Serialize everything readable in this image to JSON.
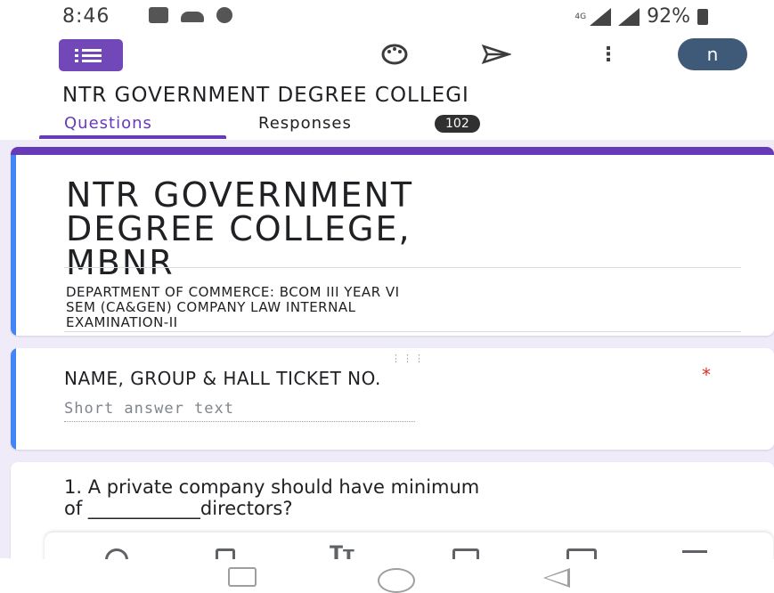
{
  "status_bar": {
    "time": "8:46",
    "network_label": "4G",
    "battery": "92%",
    "icons": [
      "usb-icon",
      "cloud-icon",
      "phone-icon",
      "signal-icon",
      "battery-icon"
    ]
  },
  "toolbar": {
    "app_icon": "google-forms-icon",
    "actions": [
      "palette-icon",
      "send-icon",
      "more-vert-icon"
    ],
    "avatar_initial": "n",
    "avatar_color": "#3f5a78"
  },
  "form_header_title": "NTR GOVERNMENT DEGREE COLLEGI",
  "tabs": {
    "questions": "Questions",
    "responses": "Responses",
    "responses_count": "102",
    "accent": "#673ab7"
  },
  "title_card": {
    "title_lines": [
      "NTR GOVERNMENT",
      "DEGREE COLLEGE,",
      "MBNR"
    ],
    "description_lines": [
      "DEPARTMENT OF COMMERCE: BCOM III YEAR VI",
      "SEM (CA&GEN) COMPANY LAW INTERNAL",
      "EXAMINATION-II"
    ]
  },
  "question_1": {
    "title": "NAME, GROUP & HALL TICKET NO.",
    "required_mark": "*",
    "answer_placeholder": "Short answer text"
  },
  "question_2": {
    "line1": "1. A private company should have minimum",
    "line2": "of ____________directors?"
  },
  "bottom_toolbar": {
    "icons": [
      "add-question-icon",
      "import-questions-icon",
      "add-title-icon",
      "add-image-icon",
      "add-video-icon",
      "add-section-icon"
    ]
  },
  "nav_bar": {
    "icons": [
      "recent-apps-icon",
      "home-icon",
      "back-icon"
    ]
  }
}
